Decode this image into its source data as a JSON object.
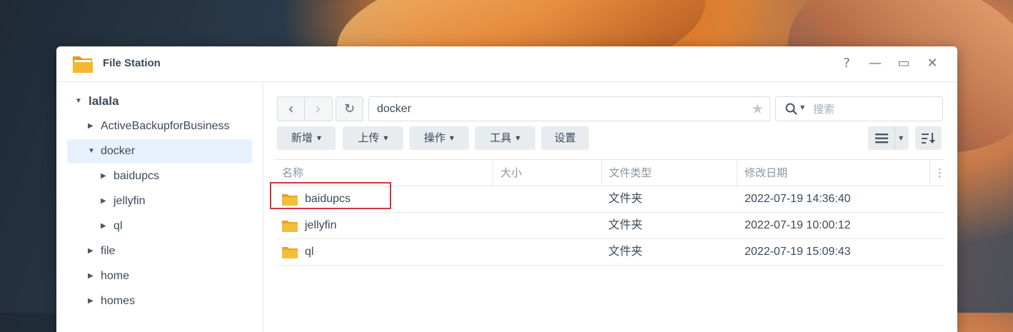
{
  "window": {
    "title": "File Station",
    "icon": "file-station-folder-icon"
  },
  "controls": {
    "help": "?",
    "minimize": "—",
    "maximize": "▭",
    "close": "✕"
  },
  "sidebar": {
    "root": "lalala",
    "items": [
      {
        "label": "ActiveBackupforBusiness",
        "expanded": false
      },
      {
        "label": "docker",
        "expanded": true,
        "selected": true
      },
      {
        "label": "baidupcs",
        "expanded": false
      },
      {
        "label": "jellyfin",
        "expanded": false
      },
      {
        "label": "ql",
        "expanded": false
      },
      {
        "label": "file",
        "expanded": false
      },
      {
        "label": "home",
        "expanded": false
      },
      {
        "label": "homes",
        "expanded": false
      }
    ]
  },
  "toolbar": {
    "path": "docker",
    "search_placeholder": "搜索",
    "buttons": [
      "新增",
      "上传",
      "操作",
      "工具",
      "设置"
    ]
  },
  "table": {
    "columns": [
      "名称",
      "大小",
      "文件类型",
      "修改日期"
    ],
    "rows": [
      {
        "name": "baidupcs",
        "size": "",
        "type": "文件夹",
        "modified": "2022-07-19 14:36:40"
      },
      {
        "name": "jellyfin",
        "size": "",
        "type": "文件夹",
        "modified": "2022-07-19 10:00:12"
      },
      {
        "name": "ql",
        "size": "",
        "type": "文件夹",
        "modified": "2022-07-19 15:09:43"
      }
    ]
  },
  "colors": {
    "accent": "#e8f1fb",
    "highlight": "#d0373d",
    "folder": "#f2b632"
  }
}
